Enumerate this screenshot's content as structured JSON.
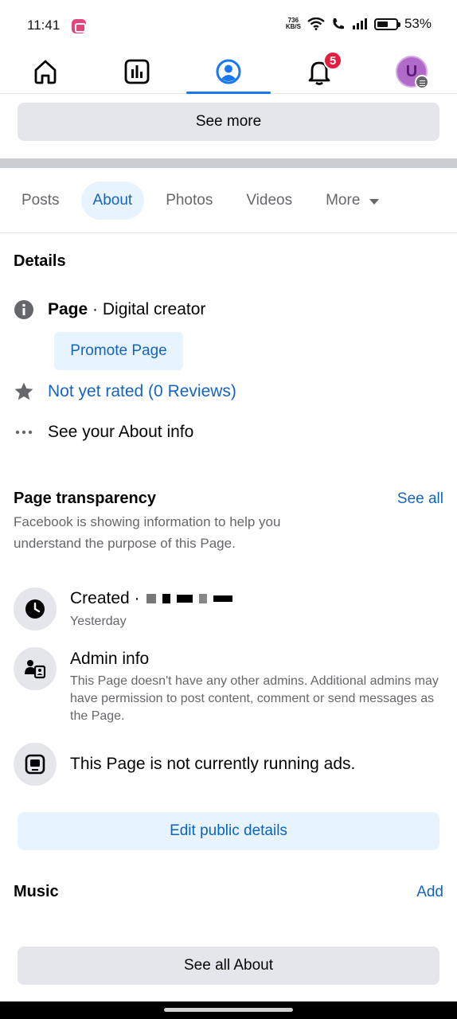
{
  "status_bar": {
    "time": "11:41",
    "net_speed_value": "736",
    "net_speed_unit": "KB/S",
    "battery_percent": "53%"
  },
  "top_nav": {
    "items": [
      "home-icon",
      "dashboard-icon",
      "profile-icon",
      "notifications-icon",
      "account-avatar"
    ],
    "active_index": 2,
    "notification_count": "5",
    "avatar_letter": "U",
    "accent_color": "#1877f2"
  },
  "see_more_label": "See more",
  "tabs": [
    "Posts",
    "About",
    "Photos",
    "Videos",
    "More"
  ],
  "active_tab": "About",
  "details": {
    "title": "Details",
    "page_label": "Page",
    "page_category": " · Digital creator",
    "promote_label": "Promote Page",
    "rating_label": "Not yet rated (0 Reviews)",
    "about_info_label": "See your About info"
  },
  "transparency": {
    "title": "Page transparency",
    "see_all_label": "See all",
    "description": "Facebook is showing information to help you understand the purpose of this Page.",
    "created_label": "Created ·",
    "created_sub": "Yesterday",
    "admin_title": "Admin info",
    "admin_description": "This Page doesn't have any other admins. Additional admins may have permission to post content, comment or send messages as the Page.",
    "ads_label": "This Page is not currently running ads."
  },
  "edit_public_details_label": "Edit public details",
  "music": {
    "title": "Music",
    "add_label": "Add"
  },
  "see_all_about_label": "See all About"
}
